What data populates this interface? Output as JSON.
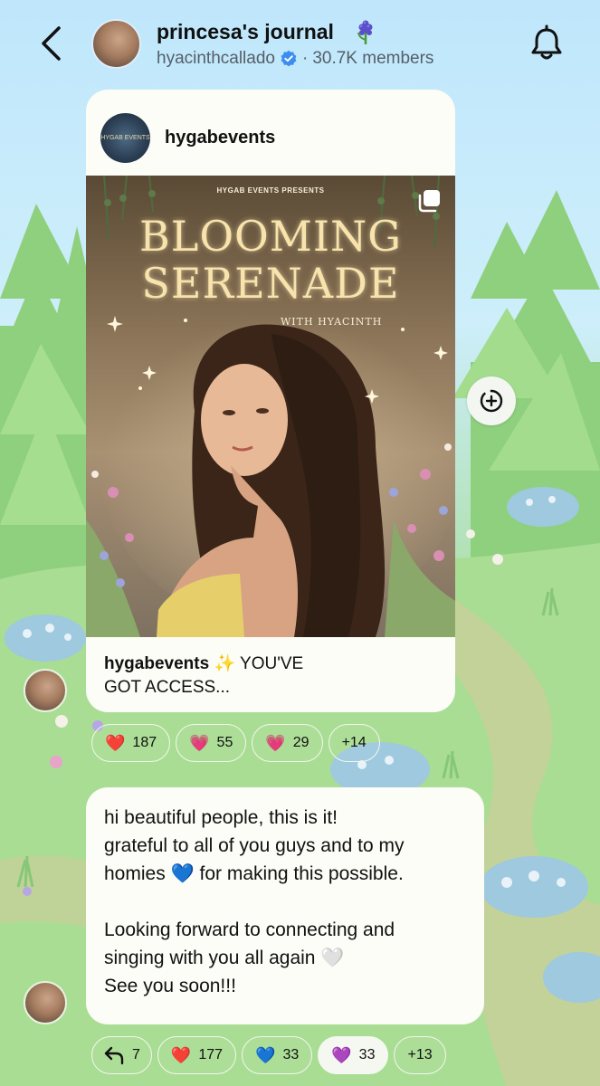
{
  "header": {
    "title": "princesa's journal",
    "title_emoji": "🪻",
    "handle": "hyacinthcallado",
    "separator": "·",
    "members": "30.7K members"
  },
  "post": {
    "author": "hygabevents",
    "avatar_text": "HYGAB EVENTS",
    "poster": {
      "presents": "HYGAB EVENTS PRESENTS",
      "title_line1": "BLOOMING",
      "title_line2": "SERENADE",
      "with": "WITH HYACINTH"
    },
    "caption_author": "hygabevents",
    "caption_emoji": "✨",
    "caption_text_1": "YOU'VE",
    "caption_text_2": "GOT ACCESS..."
  },
  "post_reactions": [
    {
      "emoji": "❤️",
      "count": "187"
    },
    {
      "emoji": "💗",
      "count": "55"
    },
    {
      "emoji": "💗",
      "count": "29"
    },
    {
      "emoji": "",
      "count": "+14"
    }
  ],
  "message": {
    "lines": [
      "hi beautiful people, this is it!",
      "grateful to all of you guys and to my",
      "homies 💙 for making this possible.",
      "",
      "Looking forward to connecting and",
      "singing with you all again 🤍",
      "See you soon!!!"
    ]
  },
  "message_reactions": [
    {
      "emoji": "↩",
      "count": "7",
      "selected": false
    },
    {
      "emoji": "❤️",
      "count": "177",
      "selected": false
    },
    {
      "emoji": "💙",
      "count": "33",
      "selected": false
    },
    {
      "emoji": "💜",
      "count": "33",
      "selected": true
    },
    {
      "emoji": "",
      "count": "+13",
      "selected": false
    }
  ],
  "colors": {
    "sky": "#c9ecfb",
    "grass": "#a8dc97",
    "card": "#fbfdf6",
    "verified": "#3b8df0"
  }
}
